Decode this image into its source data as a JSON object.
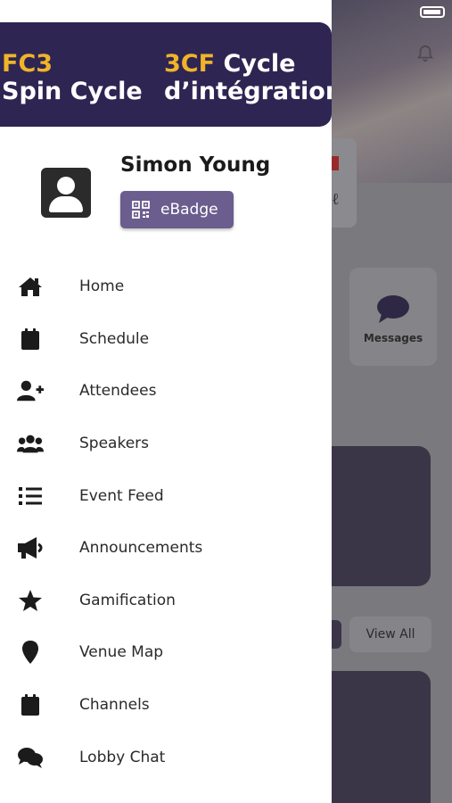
{
  "status_bar": {
    "battery_icon": "battery-icon"
  },
  "drawer": {
    "banner": {
      "line1_left": "FC3",
      "line2_left": "Spin Cycle",
      "line1_right_highlight": "3CF",
      "line1_right": "Cycle",
      "line2_right": "d’intégration"
    },
    "profile": {
      "avatar_icon": "user-icon",
      "name": "Simon Young",
      "ebadge_label": "eBadge",
      "ebadge_icon": "qr-code-icon"
    },
    "menu": [
      {
        "label": "Home",
        "icon": "home-icon"
      },
      {
        "label": "Schedule",
        "icon": "calendar-icon"
      },
      {
        "label": "Attendees",
        "icon": "user-plus-icon"
      },
      {
        "label": "Speakers",
        "icon": "users-icon"
      },
      {
        "label": "Event Feed",
        "icon": "list-icon"
      },
      {
        "label": "Announcements",
        "icon": "megaphone-icon"
      },
      {
        "label": "Gamification",
        "icon": "star-icon"
      },
      {
        "label": "Venue Map",
        "icon": "map-pin-icon"
      },
      {
        "label": "Channels",
        "icon": "calendar-icon"
      },
      {
        "label": "Lobby Chat",
        "icon": "chat-icon"
      }
    ]
  },
  "background": {
    "messages_label": "Messages",
    "view_all_label": "View All",
    "bell_icon": "bell-icon"
  },
  "colors": {
    "banner_bg": "#2f2553",
    "banner_yellow": "#f0b429",
    "ebadge_bg": "#6b5d8e",
    "overlay_bg": "#7a797e"
  }
}
